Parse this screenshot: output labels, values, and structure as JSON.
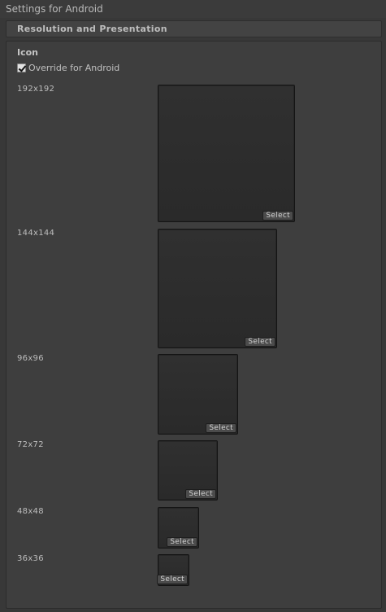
{
  "window": {
    "title": "Settings for Android"
  },
  "foldout": {
    "label": "Resolution and Presentation"
  },
  "icon_section": {
    "title": "Icon",
    "override_label": "Override for Android",
    "override_checked": true,
    "select_label": "Select",
    "slots": [
      {
        "size_label": "192x192"
      },
      {
        "size_label": "144x144"
      },
      {
        "size_label": "96x96"
      },
      {
        "size_label": "72x72"
      },
      {
        "size_label": "48x48"
      },
      {
        "size_label": "36x36"
      }
    ]
  }
}
